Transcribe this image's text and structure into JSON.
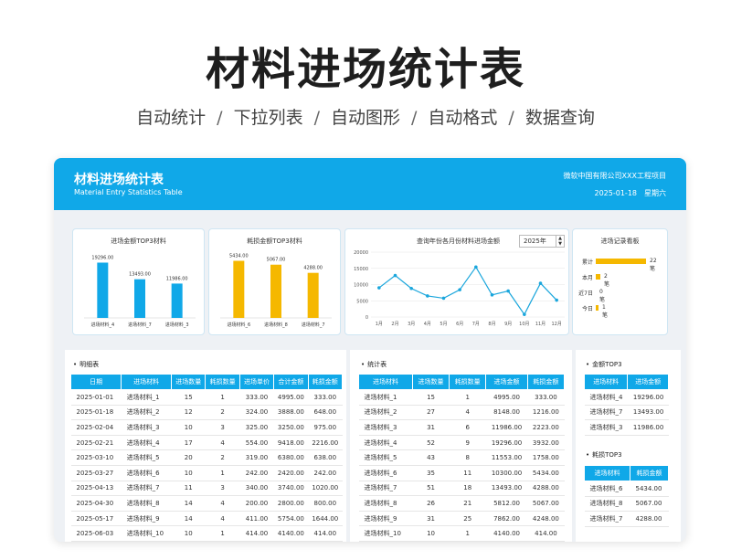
{
  "page": {
    "title": "材料进场统计表",
    "features": [
      "自动统计",
      "下拉列表",
      "自动图形",
      "自动格式",
      "数据查询"
    ]
  },
  "header": {
    "title": "材料进场统计表",
    "subtitle": "Material Entry Statistics Table",
    "company": "微软中国有限公司XXX工程项目",
    "date": "2025-01-18",
    "weekday": "星期六"
  },
  "colors": {
    "accent": "#10a8e8",
    "amount_bar": "#10a8e8",
    "loss_bar": "#f5b800",
    "line": "#1aa6dc"
  },
  "charts": {
    "amount_top3": {
      "title": "进场金额TOP3材料",
      "chart_data": {
        "type": "bar",
        "categories": [
          "进场材料_4",
          "进场材料_7",
          "进场材料_3"
        ],
        "values": [
          19296.0,
          13493.0,
          11986.0
        ],
        "labels": [
          "19296.00",
          "13493.00",
          "11986.00"
        ],
        "ylim": [
          0,
          22000
        ]
      }
    },
    "loss_top3": {
      "title": "耗损金额TOP3材料",
      "chart_data": {
        "type": "bar",
        "categories": [
          "进场材料_6",
          "进场材料_8",
          "进场材料_7"
        ],
        "values": [
          5434.0,
          5067.0,
          4288.0
        ],
        "labels": [
          "5434.00",
          "5067.00",
          "4288.00"
        ],
        "ylim": [
          0,
          6000
        ]
      }
    },
    "monthly": {
      "title": "查询年份各月份材料进场金额",
      "year": "2025年",
      "chart_data": {
        "type": "line",
        "categories": [
          "1月",
          "2月",
          "3月",
          "4月",
          "5月",
          "6月",
          "7月",
          "8月",
          "9月",
          "10月",
          "11月",
          "12月"
        ],
        "values": [
          9000,
          12800,
          8800,
          6500,
          5800,
          8400,
          15400,
          6800,
          8000,
          800,
          10400,
          5200
        ],
        "yticks": [
          "0",
          "5000",
          "10000",
          "15000",
          "20000"
        ],
        "ylim": [
          0,
          20000
        ]
      }
    }
  },
  "kpi": {
    "title": "进场记录看板",
    "rows": [
      {
        "label": "累计",
        "value": 22,
        "value_text": "22笔"
      },
      {
        "label": "本月",
        "value": 2,
        "value_text": "2笔"
      },
      {
        "label": "近7日",
        "value": 0,
        "value_text": "0笔"
      },
      {
        "label": "今日",
        "value": 1,
        "value_text": "1笔"
      }
    ]
  },
  "detail": {
    "title": "明细表",
    "columns": [
      "日期",
      "进场材料",
      "进场数量",
      "耗损数量",
      "进场单价",
      "合计金额",
      "耗损金额"
    ],
    "rows": [
      [
        "2025-01-01",
        "进场材料_1",
        "15",
        "1",
        "333.00",
        "4995.00",
        "333.00"
      ],
      [
        "2025-01-18",
        "进场材料_2",
        "12",
        "2",
        "324.00",
        "3888.00",
        "648.00"
      ],
      [
        "2025-02-04",
        "进场材料_3",
        "10",
        "3",
        "325.00",
        "3250.00",
        "975.00"
      ],
      [
        "2025-02-21",
        "进场材料_4",
        "17",
        "4",
        "554.00",
        "9418.00",
        "2216.00"
      ],
      [
        "2025-03-10",
        "进场材料_5",
        "20",
        "2",
        "319.00",
        "6380.00",
        "638.00"
      ],
      [
        "2025-03-27",
        "进场材料_6",
        "10",
        "1",
        "242.00",
        "2420.00",
        "242.00"
      ],
      [
        "2025-04-13",
        "进场材料_7",
        "11",
        "3",
        "340.00",
        "3740.00",
        "1020.00"
      ],
      [
        "2025-04-30",
        "进场材料_8",
        "14",
        "4",
        "200.00",
        "2800.00",
        "800.00"
      ],
      [
        "2025-05-17",
        "进场材料_9",
        "14",
        "4",
        "411.00",
        "5754.00",
        "1644.00"
      ],
      [
        "2025-06-03",
        "进场材料_10",
        "10",
        "1",
        "414.00",
        "4140.00",
        "414.00"
      ]
    ]
  },
  "stats": {
    "title": "统计表",
    "columns": [
      "进场材料",
      "进场数量",
      "耗损数量",
      "进场金额",
      "耗损金额"
    ],
    "rows": [
      [
        "进场材料_1",
        "15",
        "1",
        "4995.00",
        "333.00"
      ],
      [
        "进场材料_2",
        "27",
        "4",
        "8148.00",
        "1216.00"
      ],
      [
        "进场材料_3",
        "31",
        "6",
        "11986.00",
        "2223.00"
      ],
      [
        "进场材料_4",
        "52",
        "9",
        "19296.00",
        "3932.00"
      ],
      [
        "进场材料_5",
        "43",
        "8",
        "11553.00",
        "1758.00"
      ],
      [
        "进场材料_6",
        "35",
        "11",
        "10300.00",
        "5434.00"
      ],
      [
        "进场材料_7",
        "51",
        "18",
        "13493.00",
        "4288.00"
      ],
      [
        "进场材料_8",
        "26",
        "21",
        "5812.00",
        "5067.00"
      ],
      [
        "进场材料_9",
        "31",
        "25",
        "7862.00",
        "4248.00"
      ],
      [
        "进场材料_10",
        "10",
        "1",
        "4140.00",
        "414.00"
      ]
    ]
  },
  "top_amount": {
    "title": "金额TOP3",
    "columns": [
      "进场材料",
      "进场金额"
    ],
    "rows": [
      [
        "进场材料_4",
        "19296.00"
      ],
      [
        "进场材料_7",
        "13493.00"
      ],
      [
        "进场材料_3",
        "11986.00"
      ]
    ]
  },
  "top_loss": {
    "title": "耗损TOP3",
    "columns": [
      "进场材料",
      "耗损金额"
    ],
    "rows": [
      [
        "进场材料_6",
        "5434.00"
      ],
      [
        "进场材料_8",
        "5067.00"
      ],
      [
        "进场材料_7",
        "4288.00"
      ]
    ]
  }
}
